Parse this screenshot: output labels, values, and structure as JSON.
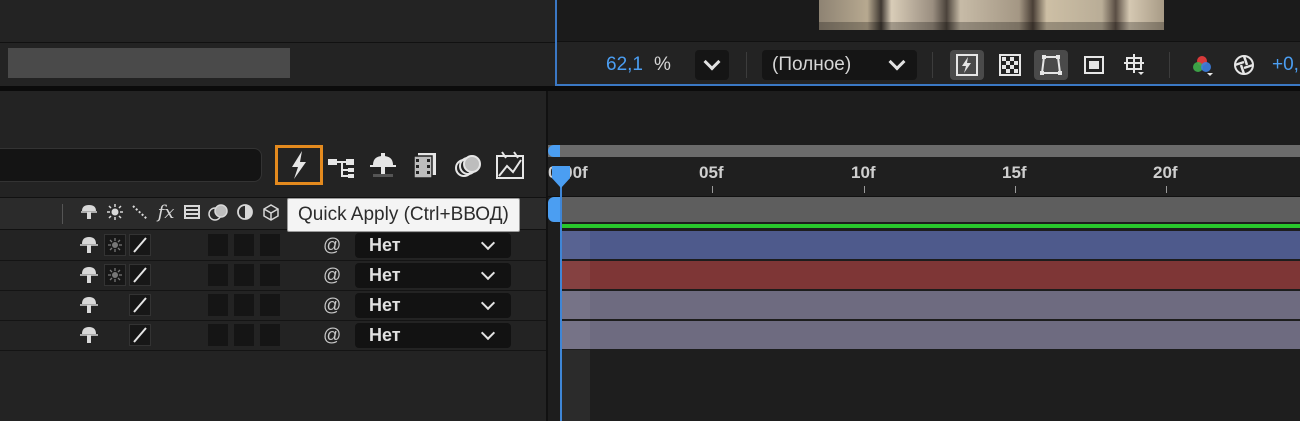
{
  "viewer": {
    "zoom_value": "62,1",
    "zoom_unit": "%",
    "resolution": "(Полное)",
    "exposure": "+0,"
  },
  "tooltip": {
    "text": "Quick Apply (Ctrl+ВВОД)"
  },
  "timeline": {
    "ruler_labels": [
      "0:00f",
      "05f",
      "10f",
      "15f",
      "20f"
    ],
    "work_area_color": "#4b9ef2",
    "playhead_color": "#4b9ef2"
  },
  "header": {
    "fx_label": "fx"
  },
  "layers": [
    {
      "mode": "Нет",
      "track_color": "#4e5a8c"
    },
    {
      "mode": "Нет",
      "track_color": "#7e3636"
    },
    {
      "mode": "Нет",
      "track_color": "#6e6b80"
    },
    {
      "mode": "Нет",
      "track_color": "#6e6b80"
    }
  ],
  "colors": {
    "accent_orange": "#e48a1e",
    "accent_blue": "#4b9ef2",
    "green_line": "#29c72c"
  }
}
